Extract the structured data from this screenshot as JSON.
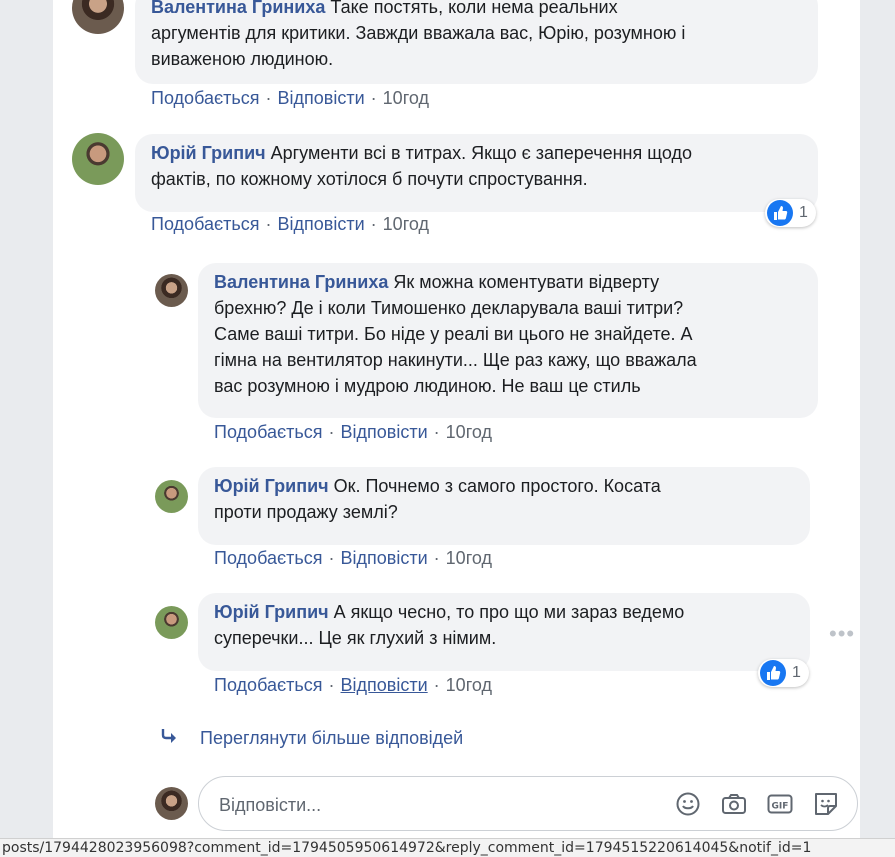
{
  "comments": [
    {
      "author": "Валентина Гриниха",
      "text": "Таке постять, коли нема реальних\nаргументів для критики. Завжди вважала вас, Юрію, розумною і\nвиваженою людиною.",
      "like": "Подобається",
      "reply": "Відповісти",
      "time": "10год"
    },
    {
      "author": "Юрій Грипич",
      "text": "Аргументи всі в титрах. Якщо є заперечення щодо\nфактів, по кожному хотілося б почути спростування.",
      "like": "Подобається",
      "reply": "Відповісти",
      "time": "10год",
      "reaction_count": "1"
    },
    {
      "author": "Валентина Гриниха",
      "text": "Як можна коментувати відверту\nбрехню? Де і коли Тимошенко декларувала ваші титри?\nСаме ваші титри. Бо ніде у реалі ви цього не знайдете. А\nгімна на вентилятор накинути... Ще раз кажу, що вважала\nвас розумною і мудрою людиною. Не ваш це стиль",
      "like": "Подобається",
      "reply": "Відповісти",
      "time": "10год"
    },
    {
      "author": "Юрій Грипич",
      "text": "Ок. Почнемо з самого простого. Косата\nпроти продажу землі?",
      "like": "Подобається",
      "reply": "Відповісти",
      "time": "10год"
    },
    {
      "author": "Юрій Грипич",
      "text": "А якщо чесно, то про що ми зараз ведемо\nсуперечки... Це як глухий з німим.",
      "like": "Подобається",
      "reply": "Відповісти",
      "time": "10год",
      "reaction_count": "1"
    }
  ],
  "separator": "·",
  "more_replies": "Переглянути більше відповідей",
  "reply_box": {
    "placeholder": "Відповісти..."
  },
  "status_url": "posts/1794428023956098?comment_id=1794505950614972&reply_comment_id=1794515220614045&notif_id=1",
  "colors": {
    "link": "#385898",
    "bubble": "#f2f3f5",
    "like_blue": "#1877f2"
  },
  "icons": [
    "like-icon",
    "reply-arrow-icon",
    "emoji-icon",
    "camera-icon",
    "gif-icon",
    "sticker-icon",
    "more-options-icon"
  ]
}
